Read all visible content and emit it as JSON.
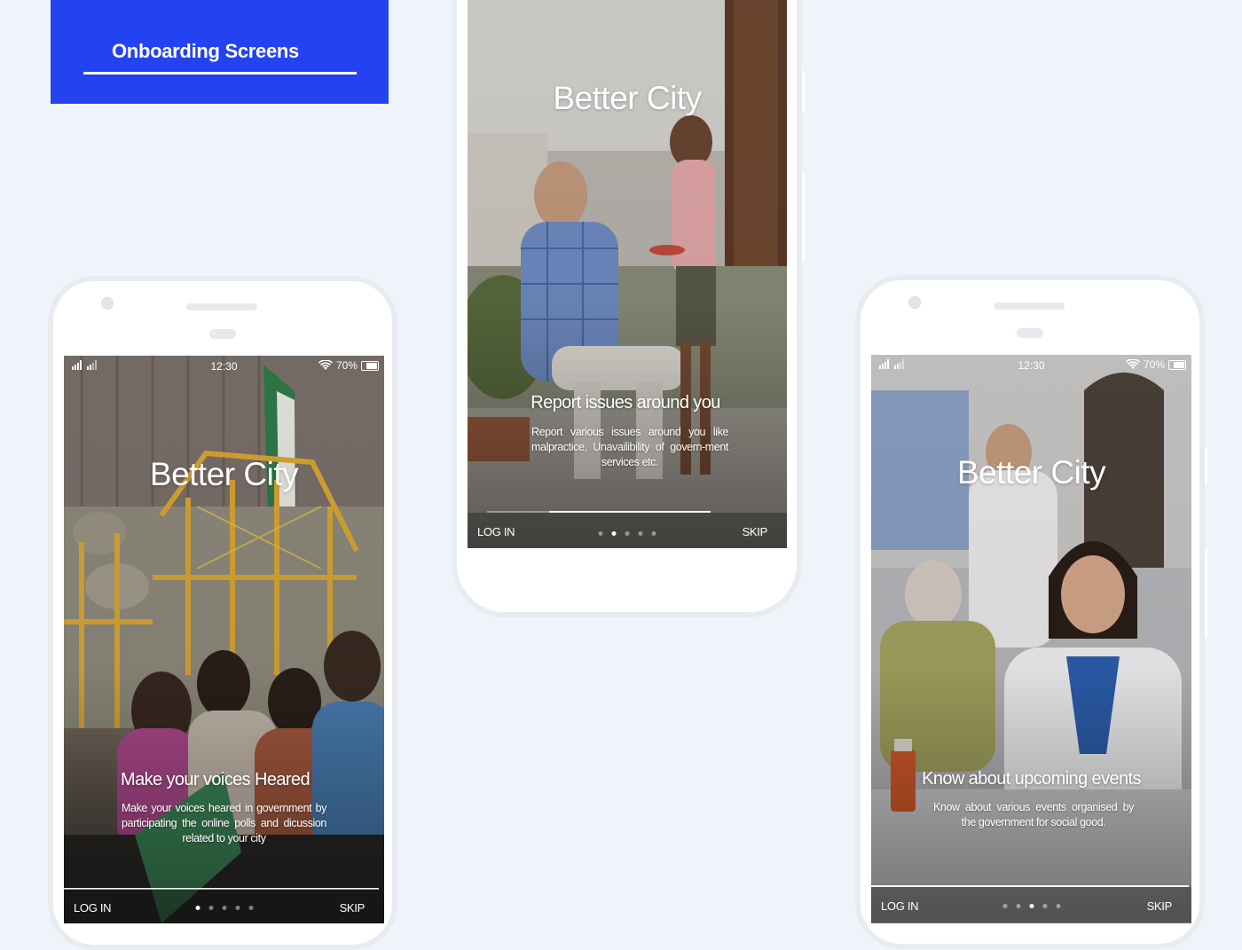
{
  "header": {
    "title": "Onboarding Screens",
    "bg_color": "#2443f0"
  },
  "screens": [
    {
      "brand": "Better City",
      "status": {
        "time": "12:30",
        "battery": "70%"
      },
      "headline": "Make your voices Heared",
      "description": "Make your voices heared in government by participating the online polls and dicussion related to your city",
      "login_label": "LOG IN",
      "skip_label": "SKIP",
      "active_dot": 0,
      "dot_count": 5,
      "photo_icon": "people-sitting-photo"
    },
    {
      "brand": "Better City",
      "headline": "Report  issues around you",
      "description": "Report various issues around you like malpractice, Unavailibility of govern-ment services etc.",
      "login_label": "LOG IN",
      "skip_label": "SKIP",
      "active_dot": 1,
      "dot_count": 5,
      "photo_icon": "man-and-boy-photo"
    },
    {
      "brand": "Better City",
      "status": {
        "time": "12:30",
        "battery": "70%"
      },
      "headline": "Know about upcoming events",
      "description": "Know about various events organised by the government for social good.",
      "login_label": "LOG IN",
      "skip_label": "SKIP",
      "active_dot": 2,
      "dot_count": 5,
      "photo_icon": "doctor-photo"
    }
  ]
}
